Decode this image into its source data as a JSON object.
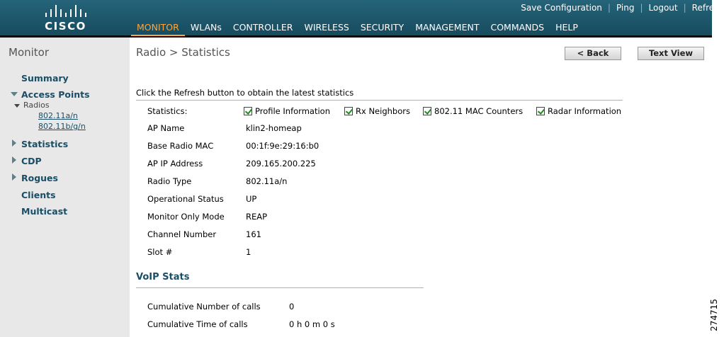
{
  "brand": {
    "name": "CISCO"
  },
  "toplinks": [
    "Save Configuration",
    "Ping",
    "Logout",
    "Refresh"
  ],
  "nav": [
    "MONITOR",
    "WLANs",
    "CONTROLLER",
    "WIRELESS",
    "SECURITY",
    "MANAGEMENT",
    "COMMANDS",
    "HELP"
  ],
  "sidebar": {
    "title": "Monitor",
    "summary": "Summary",
    "access_points": "Access Points",
    "radios": "Radios",
    "radio_a": "802.11a/n",
    "radio_bg": "802.11b/g/n",
    "statistics": "Statistics",
    "cdp": "CDP",
    "rogues": "Rogues",
    "clients": "Clients",
    "multicast": "Multicast"
  },
  "page": {
    "title": "Radio > Statistics",
    "back_label": "< Back",
    "textview_label": "Text View",
    "hint": "Click the Refresh button to obtain the latest statistics"
  },
  "statistics_label": "Statistics:",
  "checkboxes": [
    "Profile Information",
    "Rx Neighbors",
    "802.11 MAC Counters",
    "Radar Information"
  ],
  "fields": [
    {
      "label": "AP Name",
      "value": "klin2-homeap"
    },
    {
      "label": "Base Radio MAC",
      "value": "00:1f:9e:29:16:b0"
    },
    {
      "label": "AP IP Address",
      "value": "209.165.200.225"
    },
    {
      "label": "Radio Type",
      "value": "802.11a/n"
    },
    {
      "label": "Operational Status",
      "value": "UP"
    },
    {
      "label": "Monitor Only Mode",
      "value": "REAP"
    },
    {
      "label": "Channel Number",
      "value": "161"
    },
    {
      "label": "Slot #",
      "value": "1"
    }
  ],
  "voip": {
    "title": "VoIP Stats",
    "rows": [
      {
        "label": "Cumulative Number of calls",
        "value": "0"
      },
      {
        "label": "Cumulative Time of calls",
        "value": "0 h 0 m 0 s"
      }
    ]
  },
  "figure_code": "274715"
}
